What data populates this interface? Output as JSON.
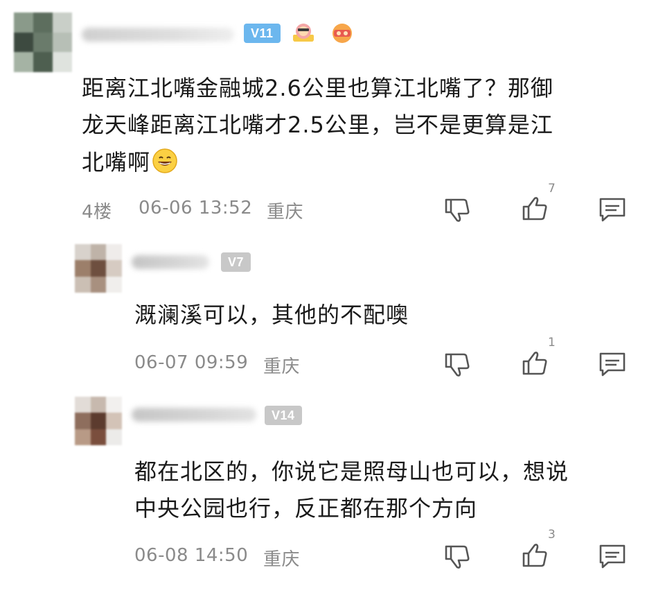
{
  "comments": [
    {
      "level": "V11",
      "content_line1": "距离江北嘴金融城2.6公里也算江北嘴了？那御",
      "content_line2": "龙天峰距离江北嘴才2.5公里，岂不是更算是江",
      "content_line3": "北嘴啊",
      "floor": "4楼",
      "time": "06-06 13:52",
      "location": "重庆",
      "likes": "7",
      "emoji": "grinning-face"
    },
    {
      "level": "V7",
      "content": "溉澜溪可以，其他的不配噢",
      "time": "06-07 09:59",
      "location": "重庆",
      "likes": "1"
    },
    {
      "level": "V14",
      "content_line1": "都在北区的，你说它是照母山也可以，想说",
      "content_line2": "中央公园也行，反正都在那个方向",
      "time": "06-08 14:50",
      "location": "重庆",
      "likes": "3"
    }
  ],
  "icons": {
    "dislike": "thumbs-down-icon",
    "like": "thumbs-up-icon",
    "reply": "comment-icon"
  },
  "colors": {
    "text": "#1a1a1a",
    "meta": "#8a8a8a",
    "badge_v11": "#6cb7ee",
    "badge_grey": "#c8c8c8"
  }
}
